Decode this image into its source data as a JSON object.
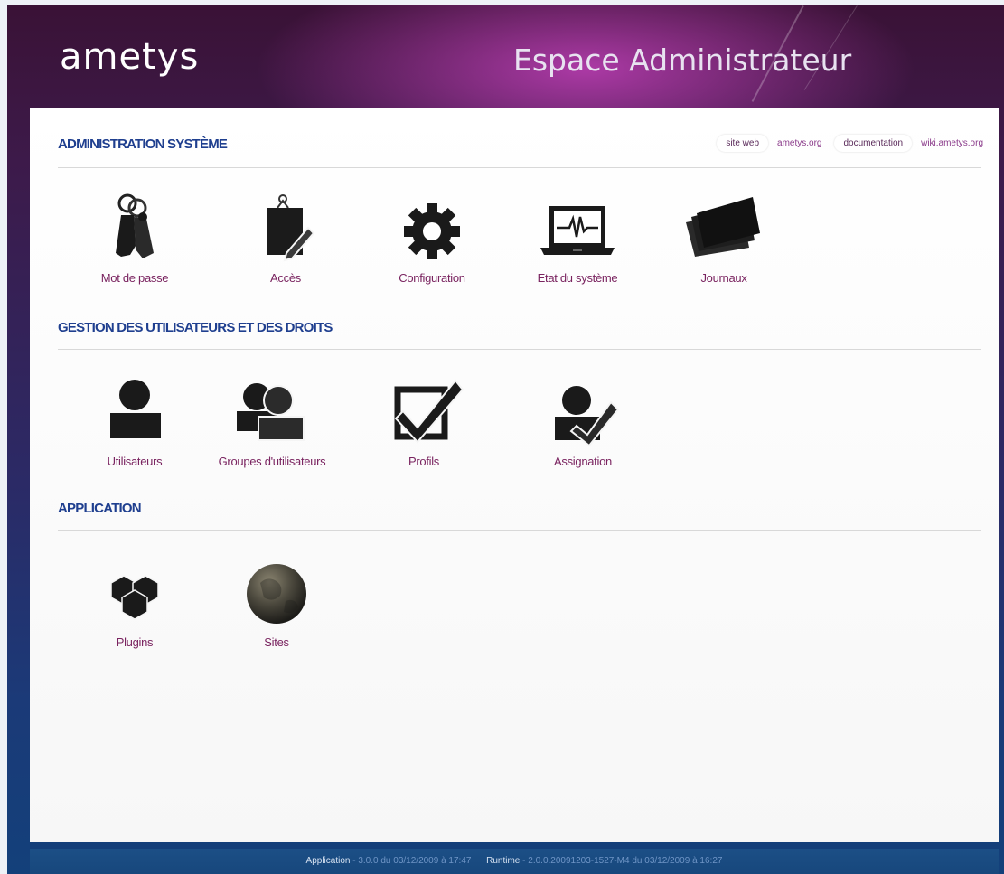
{
  "header": {
    "logo": "ametys",
    "title": "Espace Administrateur"
  },
  "links": {
    "website_label": "site web",
    "website_url": "ametys.org",
    "doc_label": "documentation",
    "doc_url": "wiki.ametys.org"
  },
  "sections": {
    "system": {
      "title": "ADMINISTRATION SYSTÈME",
      "items": [
        {
          "label": "Mot de passe",
          "icon": "password-icon"
        },
        {
          "label": "Accès",
          "icon": "access-icon"
        },
        {
          "label": "Configuration",
          "icon": "gear-icon"
        },
        {
          "label": "Etat du système",
          "icon": "system-status-icon"
        },
        {
          "label": "Journaux",
          "icon": "logs-icon"
        }
      ]
    },
    "users": {
      "title": "GESTION DES UTILISATEURS ET DES DROITS",
      "items": [
        {
          "label": "Utilisateurs",
          "icon": "user-icon"
        },
        {
          "label": "Groupes d'utilisateurs",
          "icon": "group-icon"
        },
        {
          "label": "Profils",
          "icon": "checkbox-icon"
        },
        {
          "label": "Assignation",
          "icon": "assign-icon"
        }
      ]
    },
    "application": {
      "title": "APPLICATION",
      "items": [
        {
          "label": "Plugins",
          "icon": "plugins-icon"
        },
        {
          "label": "Sites",
          "icon": "globe-icon"
        }
      ]
    }
  },
  "footer": {
    "app_label": "Application",
    "app_value": " - 3.0.0 du 03/12/2009 à 17:47",
    "runtime_label": "Runtime",
    "runtime_value": " - 2.0.0.20091203-1527-M4 du 03/12/2009 à 16:27"
  }
}
